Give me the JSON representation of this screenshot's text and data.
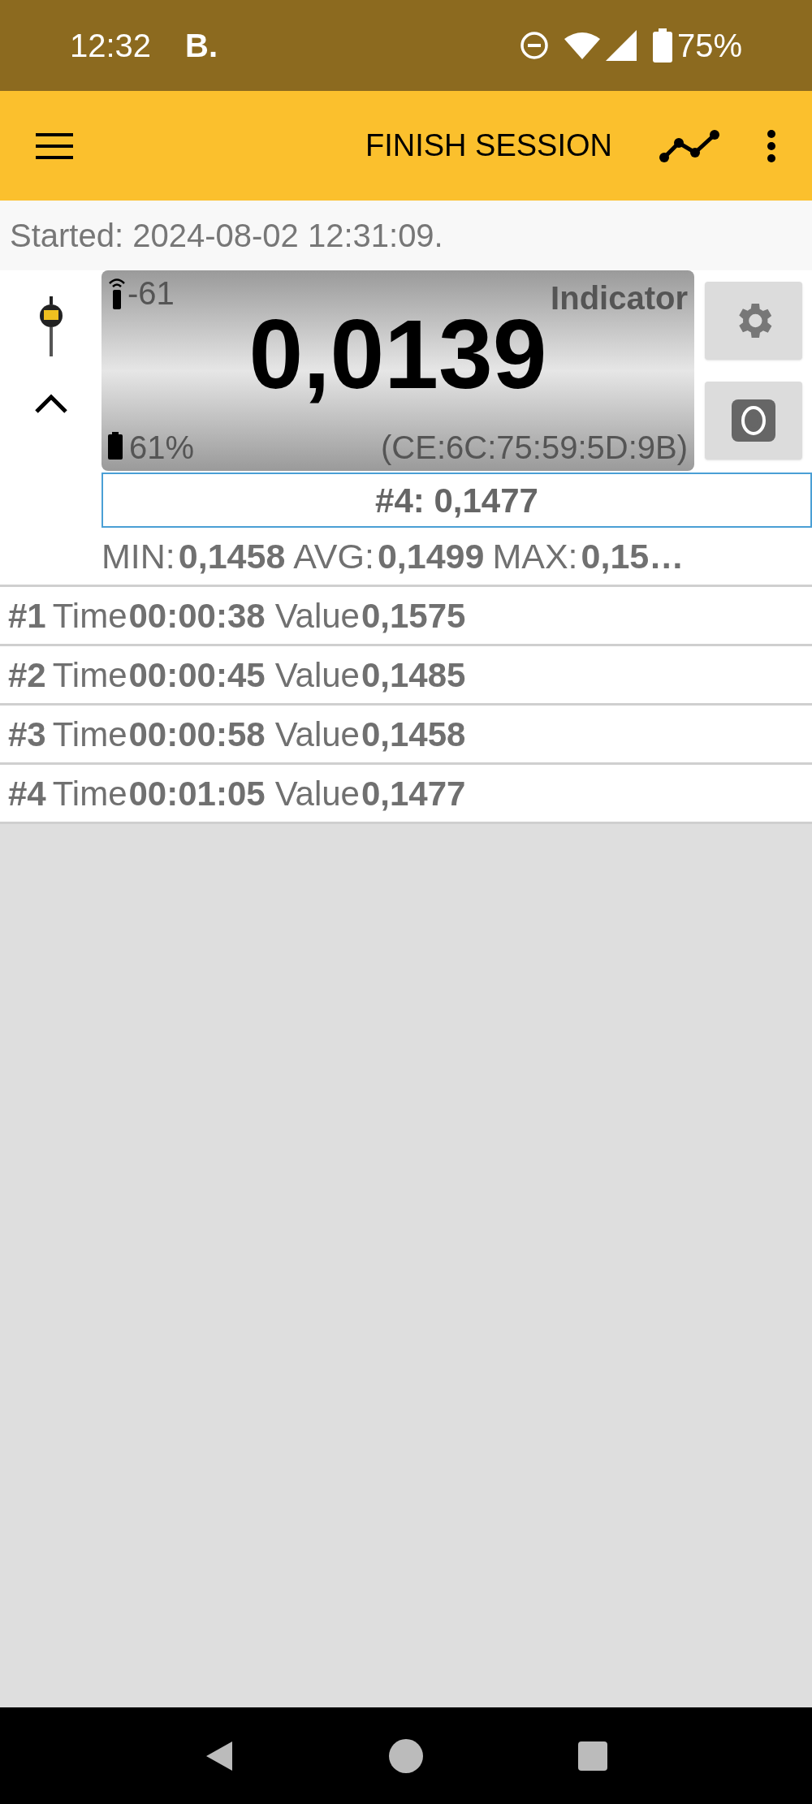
{
  "status_bar": {
    "time": "12:32",
    "notification": "B.",
    "battery": "75%"
  },
  "app_bar": {
    "title": "FINISH SESSION"
  },
  "started": "Started: 2024-08-02 12:31:09.",
  "device": {
    "expanded": true,
    "signal": "-61",
    "name": "Indicator",
    "reading": "0,0139",
    "battery": "61%",
    "address": "(CE:6C:75:59:5D:9B)"
  },
  "last_measurement": "#4: 0,1477",
  "stats": [
    {
      "label": "MIN:",
      "value": "0,1458"
    },
    {
      "label": "AVG:",
      "value": "0,1499"
    },
    {
      "label": "MAX:",
      "value": "0,15…"
    }
  ],
  "measurements": [
    {
      "index": "#1",
      "time_label": "Time",
      "time": "00:00:38",
      "value_label": "Value",
      "value": "0,1575"
    },
    {
      "index": "#2",
      "time_label": "Time",
      "time": "00:00:45",
      "value_label": "Value",
      "value": "0,1485"
    },
    {
      "index": "#3",
      "time_label": "Time",
      "time": "00:00:58",
      "value_label": "Value",
      "value": "0,1458"
    },
    {
      "index": "#4",
      "time_label": "Time",
      "time": "00:01:05",
      "value_label": "Value",
      "value": "0,1477"
    }
  ]
}
